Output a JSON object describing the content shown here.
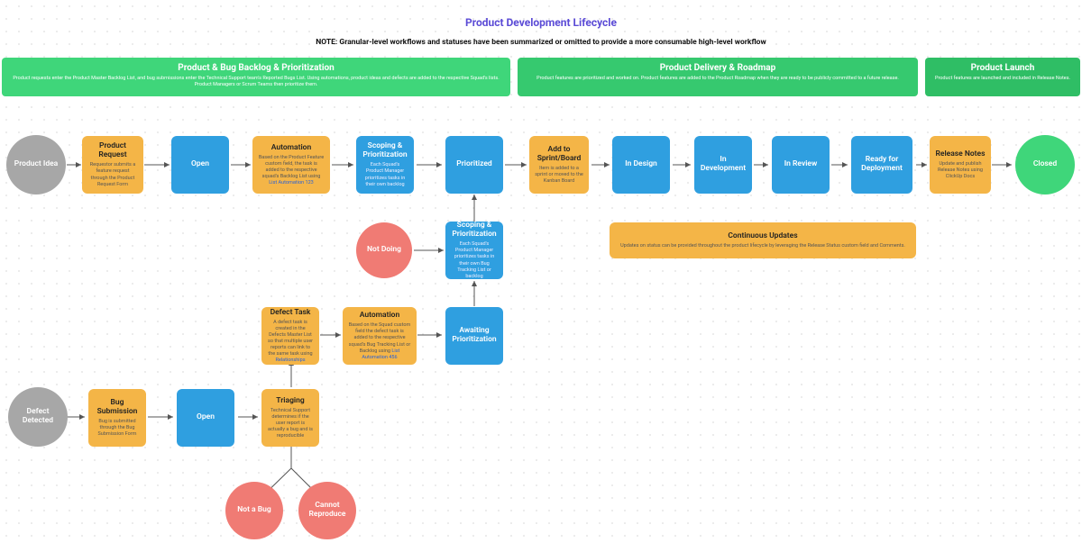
{
  "header": {
    "title": "Product Development Lifecycle",
    "subtitle": "NOTE: Granular-level workflows and statuses have been summarized or omitted to provide a more consumable high-level workflow"
  },
  "phases": {
    "p1": {
      "title": "Product & Bug Backlog & Prioritization",
      "desc": "Product requests enter the Product Master Backlog List, and bug submissions enter the Technical Support team's Reported Bugs List. Using automations, product ideas and defects are added to the respective Squad's lists. Product Managers or Scrum Teams then prioritize them."
    },
    "p2": {
      "title": "Product Delivery & Roadmap",
      "desc": "Product features are prioritized and worked on. Product features are added to the Product Roadmap when they are ready to be publicly committed to a future release."
    },
    "p3": {
      "title": "Product Launch",
      "desc": "Product features are launched and included in Release Notes."
    }
  },
  "nodes": {
    "idea": {
      "t": "Product Idea"
    },
    "request": {
      "t": "Product Request",
      "d": "Requestor submits a feature request through the Product Request Form"
    },
    "open1": {
      "t": "Open"
    },
    "auto1": {
      "t": "Automation",
      "d": "Based on the Product Feature custom field, the task is added to the respective squad's Backlog List using ",
      "link": "List Automation 123"
    },
    "scope1": {
      "t": "Scoping & Prioritization",
      "d": "Each Squad's Product Manager prioritizes tasks in their own backlog"
    },
    "prioritized": {
      "t": "Prioritized"
    },
    "addsprint": {
      "t": "Add to Sprint/Board",
      "d": "Item is added to a sprint or moved to the Kanban Board"
    },
    "indesign": {
      "t": "In Design"
    },
    "indev": {
      "t": "In Development"
    },
    "inreview": {
      "t": "In Review"
    },
    "ready": {
      "t": "Ready for Deployment"
    },
    "relnotes": {
      "t": "Release Notes",
      "d": "Update and publish Release Notes using ClickUp Docs"
    },
    "closed": {
      "t": "Closed"
    },
    "notdoing": {
      "t": "Not Doing"
    },
    "scope2": {
      "t": "Scoping & Prioritization",
      "d": "Each Squad's Product Manager prioritizes tasks in their own Bug Tracking List or backlog"
    },
    "contup": {
      "t": "Continuous Updates",
      "d": "Updates on status can be provided throughout the product lifecycle by leveraging the Release Status custom field and Comments."
    },
    "defecttask": {
      "t": "Defect Task",
      "d": "A defect task is created in the Defects Master List so that multiple user reports can link to the same task using ",
      "link": "Relationships"
    },
    "auto2": {
      "t": "Automation",
      "d": "Based on the Squad custom field the defect task is added to the respective squad's Bug Tracking List or Backlog using ",
      "link": "List Automation 456"
    },
    "awaitprio": {
      "t": "Awaiting Prioritization"
    },
    "defectdet": {
      "t": "Defect Detected"
    },
    "bugsubm": {
      "t": "Bug Submission",
      "d": "Bug is submitted through the Bug Submission Form"
    },
    "open2": {
      "t": "Open"
    },
    "triage": {
      "t": "Triaging",
      "d": "Technical Support determines if the user report is actually a bug and is reproducible"
    },
    "notbug": {
      "t": "Not a Bug"
    },
    "cantrepro": {
      "t": "Cannot Reproduce"
    }
  }
}
